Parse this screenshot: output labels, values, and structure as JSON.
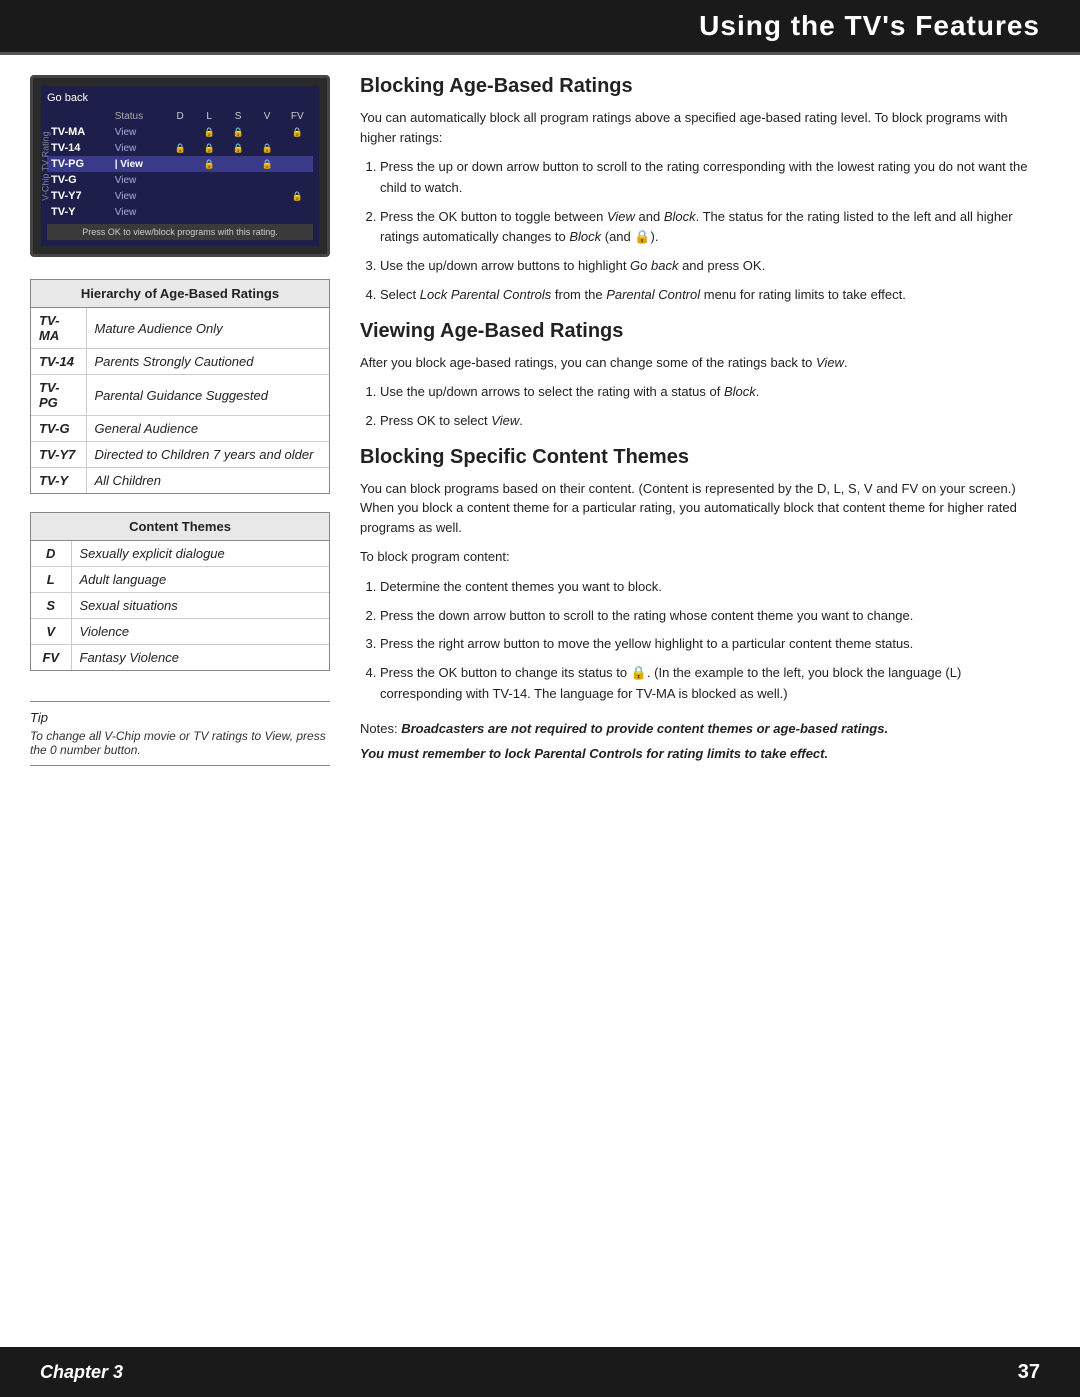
{
  "header": {
    "title": "Using the TV's Features"
  },
  "left_column": {
    "tv_screen": {
      "go_back": "Go back",
      "columns": [
        "Status",
        "D",
        "L",
        "S",
        "V",
        "FV"
      ],
      "rows": [
        {
          "code": "TV-MA",
          "status": "View",
          "d": "",
          "l": "🔒",
          "s": "🔒",
          "v": "",
          "fv": "🔒",
          "highlighted": false
        },
        {
          "code": "TV-14",
          "status": "View",
          "d": "🔒",
          "l": "🔒",
          "s": "🔒",
          "v": "🔒",
          "fv": "",
          "highlighted": false
        },
        {
          "code": "TV-PG",
          "status": "View",
          "d": "",
          "l": "🔒",
          "s": "",
          "v": "🔒",
          "fv": "",
          "highlighted": true
        },
        {
          "code": "TV-G",
          "status": "View",
          "d": "",
          "l": "",
          "s": "",
          "v": "",
          "fv": "",
          "highlighted": false
        },
        {
          "code": "TV-Y7",
          "status": "View",
          "d": "",
          "l": "",
          "s": "",
          "v": "",
          "fv": "🔒",
          "highlighted": false
        },
        {
          "code": "TV-Y",
          "status": "View",
          "d": "",
          "l": "",
          "s": "",
          "v": "",
          "fv": "",
          "highlighted": false
        }
      ],
      "bottom_text": "Press OK to view/block programs with this rating.",
      "side_label": "V-Chip TV Rating"
    },
    "age_based_table": {
      "header": "Hierarchy of Age-Based Ratings",
      "rows": [
        {
          "code": "TV-MA",
          "description": "Mature Audience Only"
        },
        {
          "code": "TV-14",
          "description": "Parents Strongly Cautioned"
        },
        {
          "code": "TV-PG",
          "description": "Parental Guidance Suggested"
        },
        {
          "code": "TV-G",
          "description": "General Audience"
        },
        {
          "code": "TV-Y7",
          "description": "Directed to Children 7 years and older"
        },
        {
          "code": "TV-Y",
          "description": "All Children"
        }
      ]
    },
    "content_themes_table": {
      "header": "Content Themes",
      "rows": [
        {
          "code": "D",
          "description": "Sexually explicit dialogue"
        },
        {
          "code": "L",
          "description": "Adult language"
        },
        {
          "code": "S",
          "description": "Sexual situations"
        },
        {
          "code": "V",
          "description": "Violence"
        },
        {
          "code": "FV",
          "description": "Fantasy Violence"
        }
      ]
    },
    "tip": {
      "title": "Tip",
      "text": "To change all V-Chip movie or TV ratings to View, press the 0 number button."
    }
  },
  "right_column": {
    "section1": {
      "title": "Blocking Age-Based Ratings",
      "intro": "You can automatically block all program ratings above a specified age-based rating level. To block programs with higher ratings:",
      "steps": [
        "Press the up or down arrow button to scroll to the rating corresponding with the lowest rating you do not want the child to watch.",
        "Press the OK button to toggle between View and Block. The status for the rating listed to the left and all higher ratings automatically changes to Block (and 🔒).",
        "Use the up/down arrow buttons to highlight Go back and press OK.",
        "Select Lock Parental Controls from the Parental Control menu for rating limits to take effect."
      ]
    },
    "section2": {
      "title": "Viewing Age-Based Ratings",
      "intro": "After you block age-based ratings, you can change some of the ratings back to View.",
      "steps": [
        "Use the up/down arrows to select the rating with a status of Block.",
        "Press OK to select View."
      ]
    },
    "section3": {
      "title": "Blocking Specific Content Themes",
      "intro": "You can block programs based on their content. (Content is represented by the D, L, S, V and FV on your screen.) When you block a content theme for a particular rating, you automatically block that content theme for higher rated programs as well.",
      "block_intro": "To block program content:",
      "steps": [
        "Determine the content themes you want to block.",
        "Press the down arrow button to scroll to the rating whose content theme you want to change.",
        "Press the right arrow button to move the yellow highlight to a particular content theme status.",
        "Press the OK button to change its status to 🔒. (In the example to the left, you block the language (L) corresponding with TV-14. The language for TV-MA is blocked as well.)"
      ],
      "notes": {
        "note1": "Broadcasters are not required to provide content themes or age-based ratings.",
        "note2": "You must remember to lock Parental Controls for rating limits to take effect."
      }
    }
  },
  "footer": {
    "chapter_label": "Chapter 3",
    "page_number": "37"
  }
}
